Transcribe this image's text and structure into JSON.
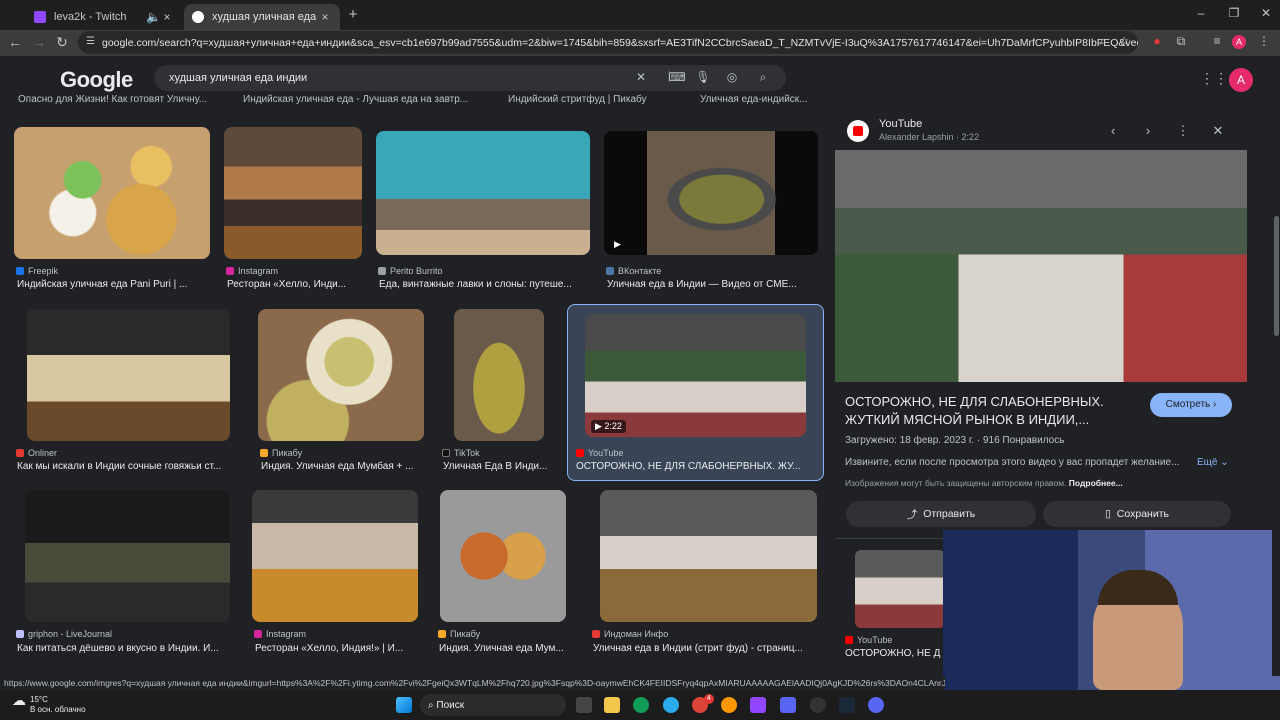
{
  "tabs": [
    {
      "title": "leva2k - Twitch",
      "active": false
    },
    {
      "title": "худшая уличная еда индии - Г",
      "active": true
    }
  ],
  "address_bar": {
    "url": "google.com/search?q=худшая+уличная+еда+индии&sca_esv=cb1e697b99ad7555&udm=2&biw=1745&bih=859&sxsrf=AE3TifN2CCbrcSaeaD_T_NZMTvVjE-I3uQ%3A1757617746147&ei=Uh7DaMrfCPyuhbIP8IbFEQ&ved=0ahUKEwjK0K..."
  },
  "google": {
    "logo": "Google",
    "query": "худшая уличная еда индии",
    "account_initial": "A"
  },
  "top_row_captions": [
    "Опасно для Жизни! Как готовят Уличну...",
    "Индийская уличная еда - Лучшая еда на завтр...",
    "Индийский стритфуд | Пикабу",
    "Уличная еда-индийск..."
  ],
  "results": [
    {
      "source": "Freepik",
      "caption": "Индийская уличная еда Pani Puri | ..."
    },
    {
      "source": "Instagram",
      "caption": "Ресторан «Хелло, Инди..."
    },
    {
      "source": "Perito Burrito",
      "caption": "Еда, винтажные лавки и слоны: путеше..."
    },
    {
      "source": "ВКонтакте",
      "caption": "Уличная еда в Индии — Видео от СМЕ..."
    },
    {
      "source": "Onliner",
      "caption": "Как мы искали в Индии сочные говяжьи ст..."
    },
    {
      "source": "Пикабу",
      "caption": "Индия. Уличная еда Мумбая + ..."
    },
    {
      "source": "TikTok",
      "caption": "Уличная Еда В Инди..."
    },
    {
      "source": "YouTube",
      "caption": "ОСТОРОЖНО, НЕ ДЛЯ СЛАБОНЕРВНЫХ. ЖУ...",
      "duration": "2:22",
      "selected": true
    },
    {
      "source": "griphon - LiveJournal",
      "caption": "Как питаться дёшево и вкусно в Индии. И..."
    },
    {
      "source": "Instagram",
      "caption": "Ресторан «Хелло, Индия!» | И..."
    },
    {
      "source": "Пикабу",
      "caption": "Индия. Уличная еда Мум..."
    },
    {
      "source": "Индоман Инфо",
      "caption": "Уличная еда в Индии (стрит фуд) - страниц..."
    }
  ],
  "preview": {
    "site": "YouTube",
    "channel": "Alexander Lapshin · 2:22",
    "title": "ОСТОРОЖНО, НЕ ДЛЯ СЛАБОНЕРВНЫХ. ЖУТКИЙ МЯСНОЙ РЫНОК В ИНДИИ,...",
    "watch_label": "Смотреть",
    "uploaded": "Загружено: 18 февр. 2023 г. · 916 Понравилось",
    "description": "Извините, если после просмотра этого видео у вас пропадет желание...",
    "more_label": "Ещё",
    "copyright": "Изображения могут быть защищены авторским правом.",
    "copyright_more": "Подробнее...",
    "share_label": "Отправить",
    "save_label": "Сохранить",
    "related_source": "YouTube",
    "related_caption": "ОСТОРОЖНО, НЕ Д"
  },
  "status_url": "https://www.google.com/imgres?q=худшая уличная еда индии&imgurl=https%3A%2F%2Fi.ytimg.com%2Fvi%2FgeiQx3WTqLM%2Fhq720.jpg%3Fsqp%3D-oaymwEhCK4FEIIDSFryq4qpAxMIARUAAAAAGAElAADIQj0AgKJD%26rs%3DAOn4CLAnrJA2uaL3ZjbeKmnL0l8",
  "taskbar": {
    "temperature": "15°C",
    "weather": "В осн. облачно",
    "search_label": "Поиск",
    "notification_badge": "4"
  },
  "icons": [
    "twitch-icon",
    "google-icon",
    "mute-icon",
    "close-icon",
    "plus-icon",
    "back-icon",
    "forward-icon",
    "reload-icon",
    "zoom-icon",
    "star-icon",
    "extensions-icon",
    "menu-icon",
    "keyboard-icon",
    "mic-icon",
    "lens-icon",
    "search-icon",
    "apps-icon",
    "play-icon",
    "youtube-icon",
    "share-icon",
    "bookmark-icon",
    "windows-icon"
  ]
}
